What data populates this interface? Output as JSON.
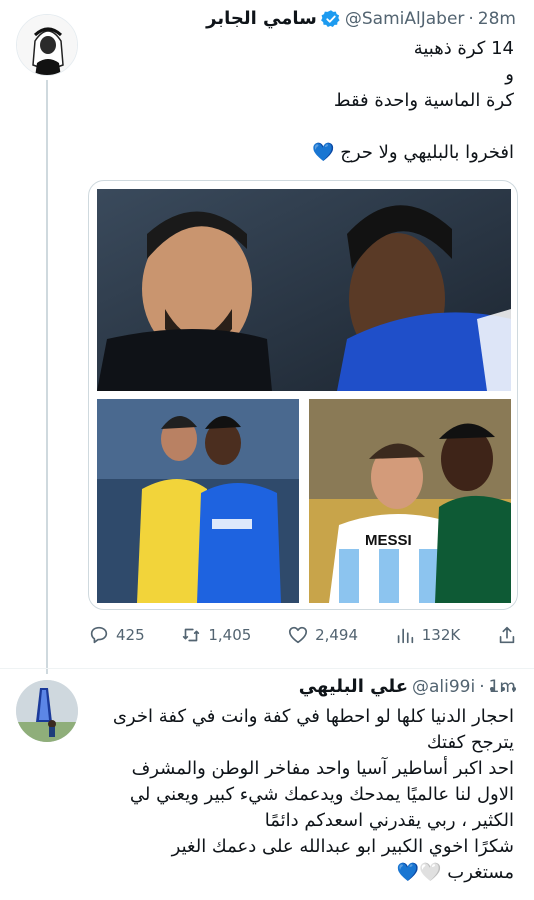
{
  "tweet": {
    "author_name": "سامي الجابر",
    "handle": "@SamiAlJaber",
    "separator": "·",
    "time": "28m",
    "lines": [
      "14 كرة ذهبية",
      "و",
      "كرة الماسية واحدة فقط",
      " ",
      "افخروا بالبليهي ولا حرج 💙"
    ],
    "photo_text": "MESSI",
    "actions": {
      "replies": "425",
      "retweets": "1,405",
      "likes": "2,494",
      "views": "132K"
    },
    "colors": {
      "verified": "#1d9bf0",
      "icon_gray": "#536471"
    }
  },
  "reply": {
    "author_name": "علي البليهي",
    "handle": "@ali99i",
    "separator": "·",
    "time": "1m",
    "lines": [
      "احجار الدنيا كلها لو احطها في كفة وانت في كفة اخرى",
      "يترجح كفتك",
      "احد اكبر أساطير آسيا واحد مفاخر الوطن والمشرف",
      "الاول لنا عالميًا يمدحك ويدعمك شيء كبير ويعني لي",
      "الكثير ، ربي يقدرني اسعدكم دائمًا",
      "شكرًا اخوي الكبير ابو عبدالله على دعمك الغير",
      "مستغرب 🤍💙"
    ]
  }
}
